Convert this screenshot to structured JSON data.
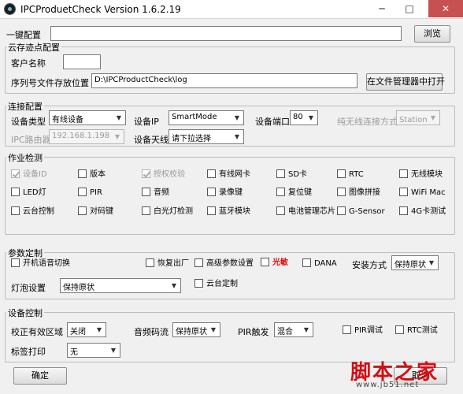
{
  "window": {
    "title": "IPCProduetCheck Version 1.6.2.19",
    "minimize": "─",
    "maximize": "□",
    "close": "✕"
  },
  "onekey": {
    "label": "一键配置",
    "value": "",
    "browse": "浏览"
  },
  "cloud": {
    "title": "云存迹点配置",
    "customer_label": "客户名称",
    "customer_value": "",
    "serial_label": "序列号文件存放位置",
    "serial_path": "D:\\IPCProductCheck\\log",
    "open_button": "在文件管理器中打开"
  },
  "connection": {
    "title": "连接配置",
    "device_type_label": "设备类型",
    "device_type": "有线设备",
    "device_ip_label": "设备IP",
    "device_ip": "SmartMode",
    "device_port_label": "设备端口",
    "device_port": "80",
    "wireless_mode_label": "纯无线连接方式",
    "wireless_mode": "Station模",
    "ipc_router_label": "IPC路由器",
    "ipc_router": "192.168.1.198",
    "antenna_label": "设备天线",
    "antenna": "请下拉选择"
  },
  "tests": {
    "title": "作业检测",
    "items": [
      {
        "label": "设备ID",
        "checked": true,
        "disabled": true
      },
      {
        "label": "版本",
        "checked": false,
        "disabled": false
      },
      {
        "label": "授权校验",
        "checked": true,
        "disabled": true
      },
      {
        "label": "有线网卡",
        "checked": false,
        "disabled": false
      },
      {
        "label": "SD卡",
        "checked": false,
        "disabled": false
      },
      {
        "label": "RTC",
        "checked": false,
        "disabled": false
      },
      {
        "label": "无线模块",
        "checked": false,
        "disabled": false
      },
      {
        "label": "LED灯",
        "checked": false,
        "disabled": false
      },
      {
        "label": "PIR",
        "checked": false,
        "disabled": false
      },
      {
        "label": "音频",
        "checked": false,
        "disabled": false
      },
      {
        "label": "录像键",
        "checked": false,
        "disabled": false
      },
      {
        "label": "复位键",
        "checked": false,
        "disabled": false
      },
      {
        "label": "图像拼接",
        "checked": false,
        "disabled": false
      },
      {
        "label": "WiFi Mac",
        "checked": false,
        "disabled": false
      },
      {
        "label": "云台控制",
        "checked": false,
        "disabled": false
      },
      {
        "label": "对码键",
        "checked": false,
        "disabled": false
      },
      {
        "label": "白光灯检测",
        "checked": false,
        "disabled": false
      },
      {
        "label": "蓝牙模块",
        "checked": false,
        "disabled": false
      },
      {
        "label": "电池管理芯片",
        "checked": false,
        "disabled": false
      },
      {
        "label": "G-Sensor",
        "checked": false,
        "disabled": false
      },
      {
        "label": "4G卡测试",
        "checked": false,
        "disabled": false
      }
    ]
  },
  "params": {
    "title": "参数定制",
    "voice_switch": "开机语音切换",
    "factory_reset": "恢复出厂",
    "advanced": "高级参数设置",
    "light_sensitive": "光敏",
    "dana": "DANA",
    "install_label": "安装方式",
    "install": "保持原状",
    "bulb_label": "灯泡设置",
    "bulb": "保持原状",
    "ptz_custom": "云台定制"
  },
  "device": {
    "title": "设备控制",
    "region_label": "校正有效区域",
    "region": "关闭",
    "audio_label": "音频码流",
    "audio": "保持原状",
    "pir_label": "PIR触发",
    "pir": "混合",
    "pir_debug": "PIR调试",
    "rtc_test": "RTC测试",
    "tag_label": "标签打印",
    "tag": "无"
  },
  "footer": {
    "ok": "确定",
    "cancel": "取消"
  },
  "watermark": {
    "text": "脚本之家",
    "url": "www.jb51.net"
  }
}
